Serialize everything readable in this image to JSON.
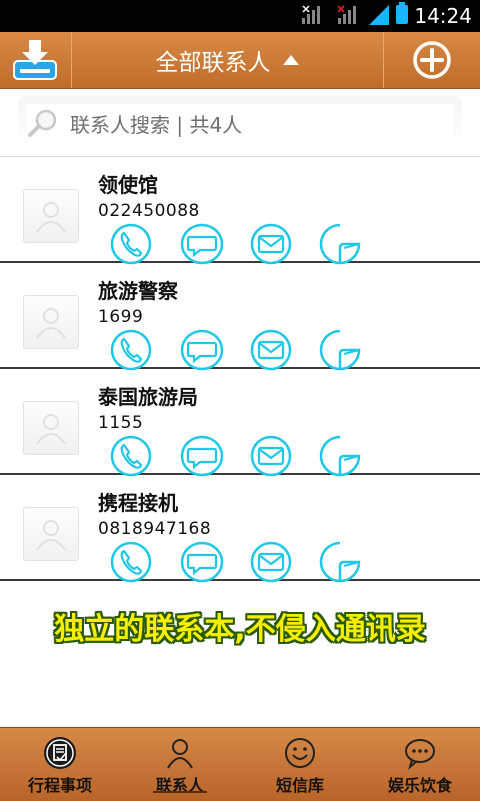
{
  "status_bar": {
    "time": "14:24"
  },
  "header": {
    "title": "全部联系人"
  },
  "search": {
    "placeholder": "联系人搜索 | 共4人"
  },
  "contacts": [
    {
      "name": "领使馆",
      "phone": "022450088"
    },
    {
      "name": "旅游警察",
      "phone": "1699"
    },
    {
      "name": "泰国旅游局",
      "phone": "1155"
    },
    {
      "name": "携程接机",
      "phone": "0818947168"
    }
  ],
  "slogan": "独立的联系本,不侵入通讯录",
  "bottom_nav": [
    {
      "label": "行程事项",
      "icon": "itinerary-icon"
    },
    {
      "label": "联系人",
      "icon": "person-icon",
      "active": true
    },
    {
      "label": "短信库",
      "icon": "smiley-icon"
    },
    {
      "label": "娱乐饮食",
      "icon": "chat-bubble-icon"
    }
  ],
  "colors": {
    "header": "#c87633",
    "action_icon": "#1ec8e6",
    "slogan_text": "#f7ee00",
    "slogan_outline": "#2a5a00"
  }
}
